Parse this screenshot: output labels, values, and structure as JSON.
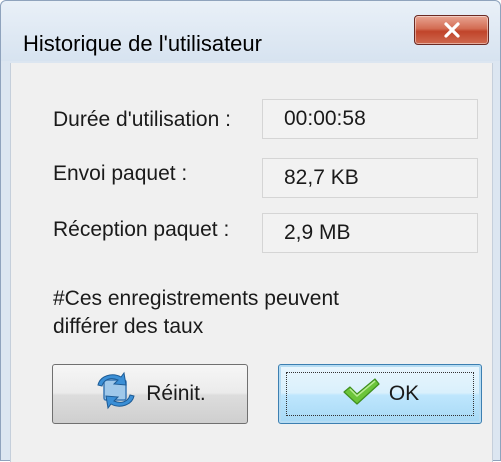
{
  "window": {
    "title": "Historique de l'utilisateur"
  },
  "rows": [
    {
      "label": "Durée d'utilisation :",
      "value": "00:00:58"
    },
    {
      "label": "Envoi paquet :",
      "value": "82,7 KB"
    },
    {
      "label": "Réception paquet :",
      "value": "2,9 MB"
    }
  ],
  "note": {
    "line1": "#Ces enregistrements peuvent",
    "line2": "différer des taux"
  },
  "buttons": {
    "reset_label": "Réinit.",
    "ok_label": "OK"
  },
  "icons": {
    "close": "close-icon",
    "reset": "reset-arrows-icon",
    "ok": "checkmark-icon"
  },
  "colors": {
    "close_button": "#c9553a",
    "ok_button": "#bee6fd",
    "checkmark": "#5cb82e"
  }
}
